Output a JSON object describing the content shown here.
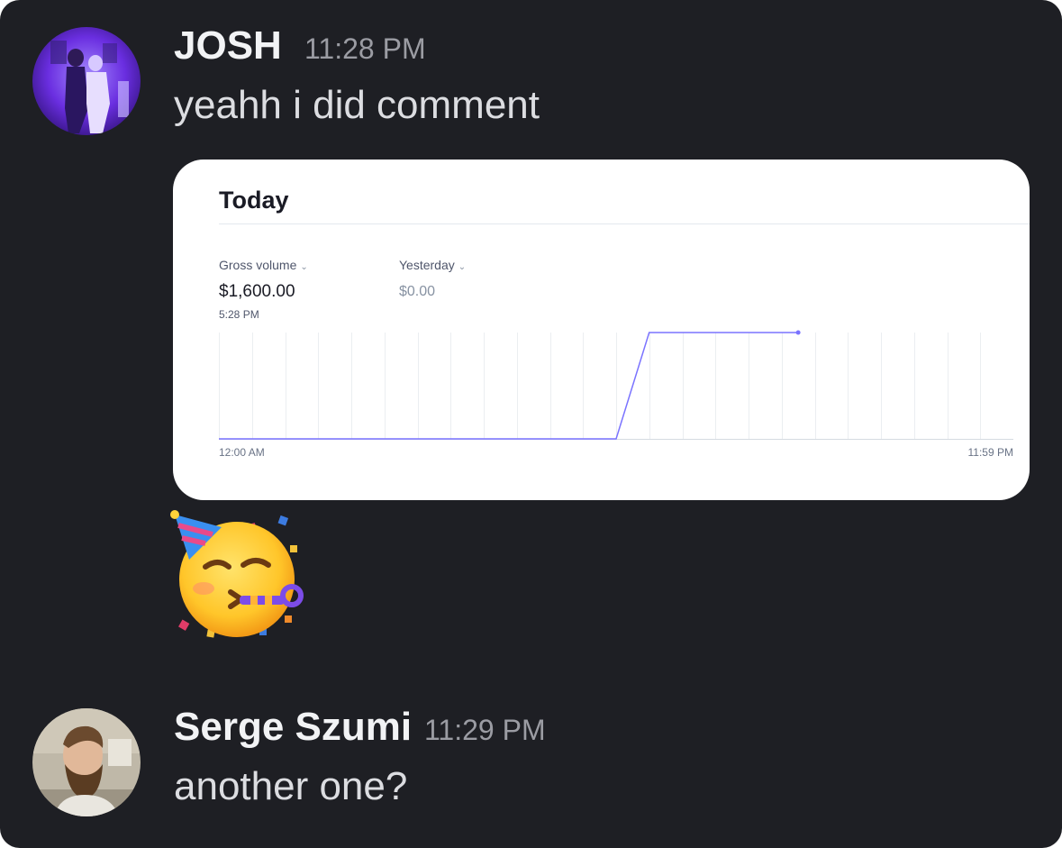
{
  "messages": [
    {
      "username": "JOSH",
      "time": "11:28 PM",
      "text": "yeahh i did comment",
      "avatar_icon": "user-photo-purple"
    },
    {
      "username": "Serge Szumi",
      "time": "11:29 PM",
      "text": "another one?",
      "avatar_icon": "user-photo-bearded"
    }
  ],
  "attachment": {
    "title": "Today",
    "primary_metric": {
      "label": "Gross volume",
      "value": "$1,600.00",
      "time": "5:28 PM"
    },
    "compare_metric": {
      "label": "Yesterday",
      "value": "$0.00"
    },
    "accent_color": "#7a73ff"
  },
  "reaction_emoji": "partying-face-emoji",
  "chart_data": {
    "type": "line",
    "x_start_label": "12:00 AM",
    "x_end_label": "11:59 PM",
    "x_hours": [
      0,
      12,
      13,
      17.5
    ],
    "values": [
      0,
      0,
      1600,
      1600
    ],
    "ylim": [
      0,
      1600
    ],
    "xlim": [
      0,
      24
    ],
    "grid": true,
    "line_color": "#7a73ff"
  }
}
